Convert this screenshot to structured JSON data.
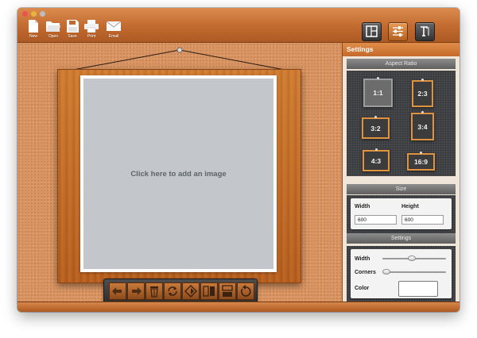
{
  "toolbar": {
    "new_label": "New",
    "open_label": "Open",
    "save_label": "Save",
    "print_label": "Print",
    "email_label": "Email"
  },
  "canvas": {
    "placeholder": "Click here to add an image"
  },
  "sidebar": {
    "title": "Settings",
    "aspect_ratio": {
      "section_label": "Aspect Ratio",
      "options": [
        "1:1",
        "2:3",
        "3:2",
        "3:4",
        "4:3",
        "16:9"
      ],
      "selected": "1:1"
    },
    "size": {
      "section_label": "Size",
      "width_label": "Width",
      "height_label": "Height",
      "width_value": "600",
      "height_value": "600"
    },
    "settings": {
      "section_label": "Settings",
      "width_label": "Width",
      "corners_label": "Corners",
      "color_label": "Color",
      "width_level": 0.45,
      "corners_level": 0.0,
      "color_value": "#ffffff"
    }
  },
  "colors": {
    "accent": "#e0923e",
    "wood": "#c9703a"
  },
  "icons": [
    "new-icon",
    "open-icon",
    "save-icon",
    "print-icon",
    "email-icon",
    "layout-icon",
    "settings-icon",
    "text-icon",
    "undo-icon",
    "redo-icon",
    "trash-icon",
    "rotate-icon",
    "flip-diagonal-icon",
    "flip-horizontal-icon",
    "flip-vertical-icon",
    "reset-icon"
  ]
}
